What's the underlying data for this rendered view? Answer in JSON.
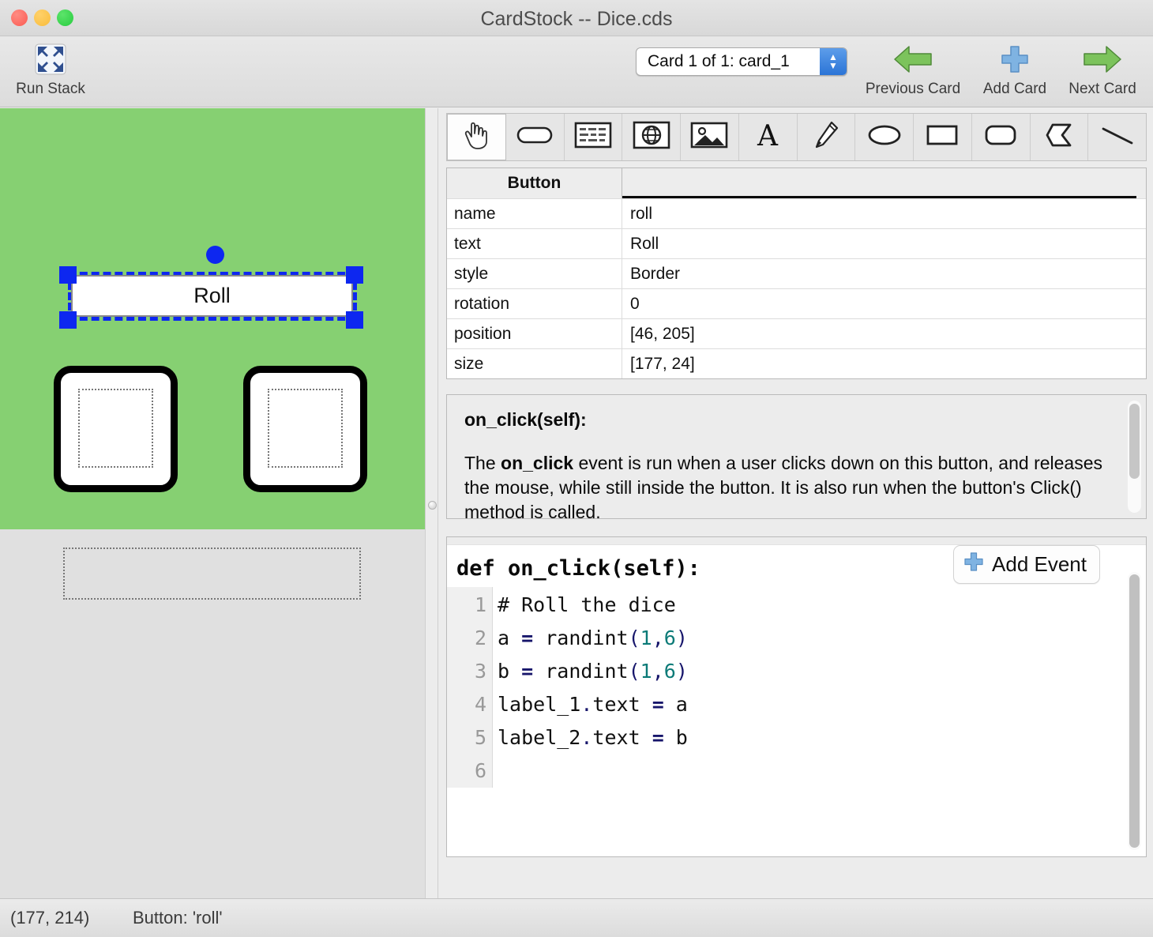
{
  "window": {
    "title": "CardStock -- Dice.cds",
    "traffic_lights": [
      "close",
      "minimize",
      "zoom"
    ]
  },
  "toolbar": {
    "run_stack": {
      "label": "Run Stack",
      "icon": "expand-arrows-icon"
    },
    "card_picker": {
      "value": "Card 1 of 1: card_1",
      "icon": "stepper-icon"
    },
    "previous_card": {
      "label": "Previous Card",
      "icon": "left-arrow-icon"
    },
    "add_card": {
      "label": "Add Card",
      "icon": "plus-icon"
    },
    "next_card": {
      "label": "Next Card",
      "icon": "right-arrow-icon"
    }
  },
  "tool_palette": {
    "selected": "hand",
    "tools": [
      {
        "name": "hand",
        "icon": "hand-icon"
      },
      {
        "name": "button",
        "icon": "button-icon"
      },
      {
        "name": "text-field",
        "icon": "text-field-icon"
      },
      {
        "name": "web-view",
        "icon": "globe-icon"
      },
      {
        "name": "image",
        "icon": "image-icon"
      },
      {
        "name": "text-label",
        "icon": "letter-a-icon"
      },
      {
        "name": "pen",
        "icon": "pencil-icon"
      },
      {
        "name": "oval",
        "icon": "oval-icon"
      },
      {
        "name": "rectangle",
        "icon": "rectangle-icon"
      },
      {
        "name": "round-rectangle",
        "icon": "round-rectangle-icon"
      },
      {
        "name": "polygon",
        "icon": "polygon-icon"
      },
      {
        "name": "line",
        "icon": "line-icon"
      }
    ]
  },
  "canvas": {
    "background_color": "#86d072",
    "selected_button_text": "Roll",
    "objects": [
      "roll-button",
      "die-1",
      "die-2",
      "free-label"
    ]
  },
  "properties": {
    "header": {
      "type": "Button",
      "value_col": ""
    },
    "rows": [
      {
        "key": "name",
        "value": "roll"
      },
      {
        "key": "text",
        "value": "Roll"
      },
      {
        "key": "style",
        "value": "Border"
      },
      {
        "key": "rotation",
        "value": "0"
      },
      {
        "key": "position",
        "value": "[46, 205]"
      },
      {
        "key": "size",
        "value": "[177, 24]"
      }
    ]
  },
  "docs": {
    "title": "on_click(self):",
    "paragraph": {
      "pre": "The ",
      "bold": "on_click",
      "post": " event is run when a user clicks down on this button, and releases the mouse, while still inside the button. It is also run when the button's Click() method is called."
    }
  },
  "code": {
    "def_line": "def on_click(self):",
    "add_event_label": "Add Event",
    "add_event_icon": "plus-icon",
    "lines": [
      {
        "num": "1",
        "text": "# Roll the dice"
      },
      {
        "num": "2",
        "text": "a = randint(1,6)"
      },
      {
        "num": "3",
        "text": "b = randint(1,6)"
      },
      {
        "num": "4",
        "text": "label_1.text = a"
      },
      {
        "num": "5",
        "text": "label_2.text = b"
      },
      {
        "num": "6",
        "text": ""
      }
    ]
  },
  "status": {
    "coords": "(177, 214)",
    "selection": "Button: 'roll'"
  }
}
